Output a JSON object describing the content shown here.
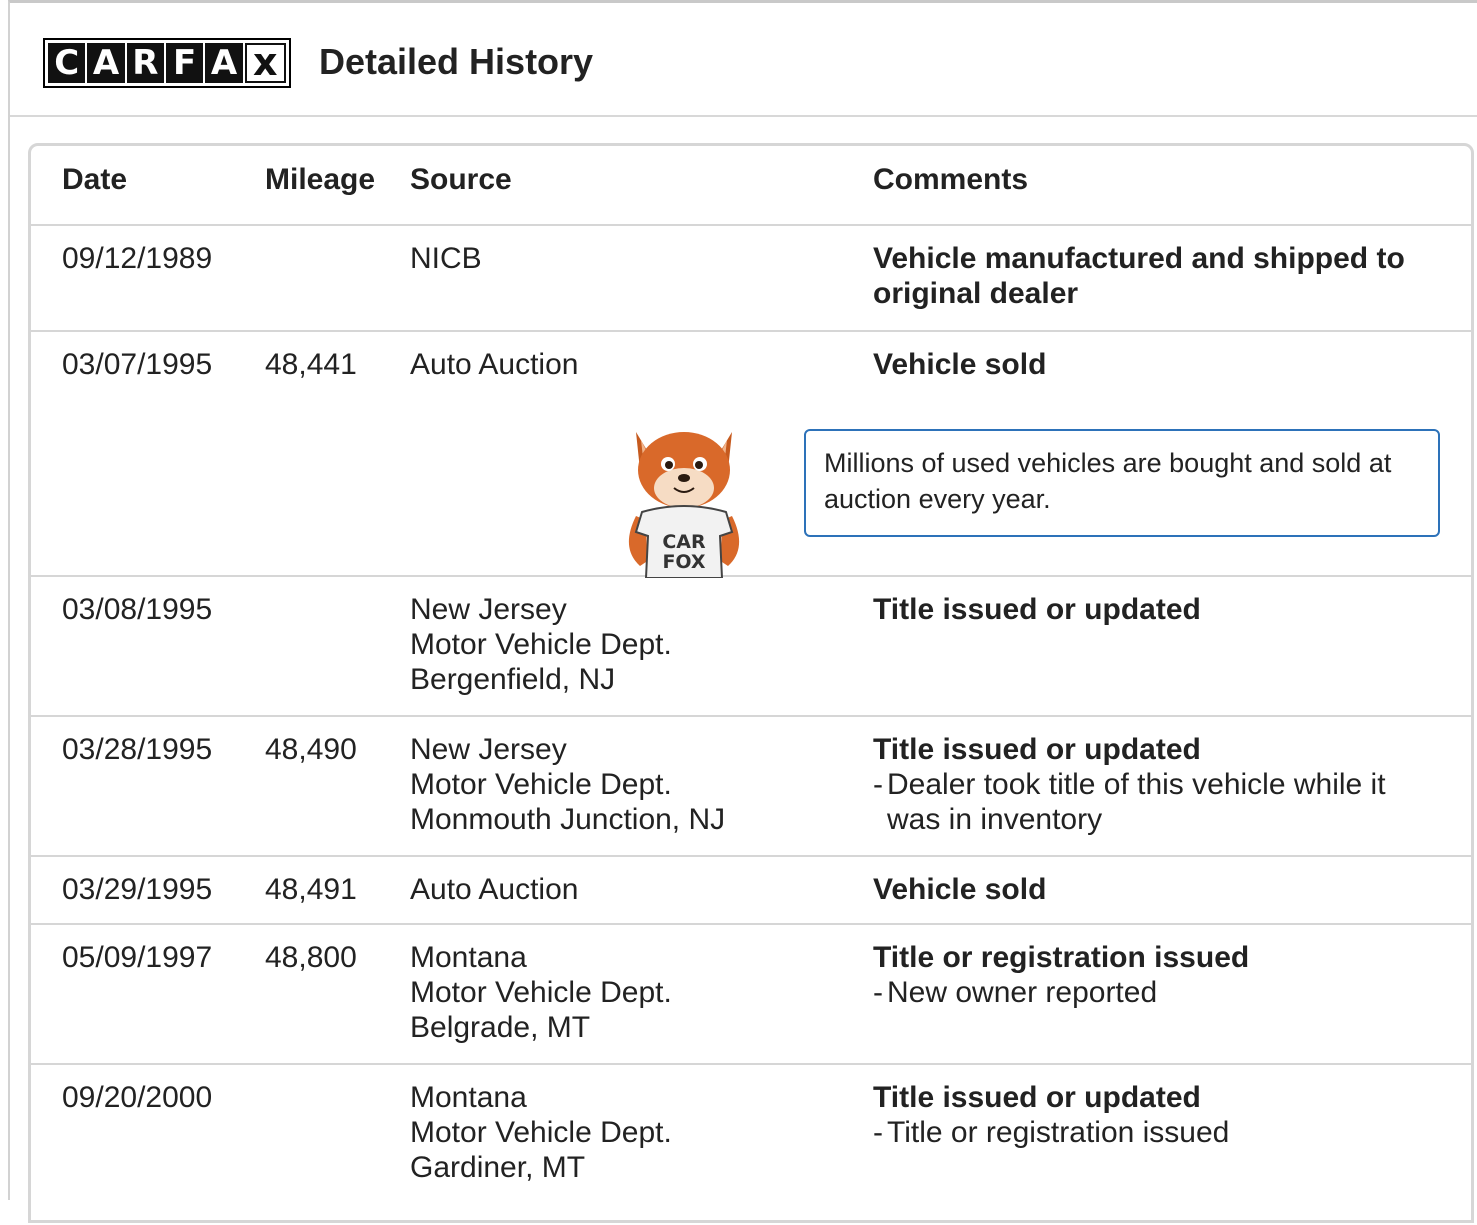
{
  "logo": {
    "letters": [
      "C",
      "A",
      "R",
      "F",
      "A",
      "x"
    ]
  },
  "header": {
    "title": "Detailed History"
  },
  "table": {
    "columns": {
      "date": "Date",
      "mileage": "Mileage",
      "source": "Source",
      "comments": "Comments"
    },
    "rows": [
      {
        "date": "09/12/1989",
        "mileage": "",
        "source": [
          "NICB"
        ],
        "comment_title_lines": [
          "Vehicle manufactured and shipped to",
          "original dealer"
        ],
        "details": []
      },
      {
        "date": "03/07/1995",
        "mileage": "48,441",
        "source": [
          "Auto Auction"
        ],
        "comment_title_lines": [
          "Vehicle sold"
        ],
        "details": []
      },
      {
        "date": "03/08/1995",
        "mileage": "",
        "source": [
          "New Jersey",
          "Motor Vehicle Dept.",
          "Bergenfield, NJ"
        ],
        "comment_title_lines": [
          "Title issued or updated"
        ],
        "details": []
      },
      {
        "date": "03/28/1995",
        "mileage": "48,490",
        "source": [
          "New Jersey",
          "Motor Vehicle Dept.",
          "Monmouth Junction, NJ"
        ],
        "comment_title_lines": [
          "Title issued or updated"
        ],
        "details": [
          [
            "Dealer took title of this vehicle while it",
            "was in inventory"
          ]
        ]
      },
      {
        "date": "03/29/1995",
        "mileage": "48,491",
        "source": [
          "Auto Auction"
        ],
        "comment_title_lines": [
          "Vehicle sold"
        ],
        "details": []
      },
      {
        "date": "05/09/1997",
        "mileage": "48,800",
        "source": [
          "Montana",
          "Motor Vehicle Dept.",
          "Belgrade, MT"
        ],
        "comment_title_lines": [
          "Title or registration issued"
        ],
        "details": [
          [
            "New owner reported"
          ]
        ]
      },
      {
        "date": "09/20/2000",
        "mileage": "",
        "source": [
          "Montana",
          "Motor Vehicle Dept.",
          "Gardiner, MT"
        ],
        "comment_title_lines": [
          "Title issued or updated"
        ],
        "details": [
          [
            "Title or registration issued"
          ]
        ]
      }
    ],
    "tip": {
      "lines": [
        "Millions of used vehicles are bought and sold at",
        "auction every year."
      ]
    },
    "mascot": {
      "shirt_lines": [
        "CAR",
        "FOX"
      ]
    }
  },
  "colors": {
    "tip_border": "#2d72b9",
    "divider": "#d6d6d6",
    "text": "#222222"
  }
}
